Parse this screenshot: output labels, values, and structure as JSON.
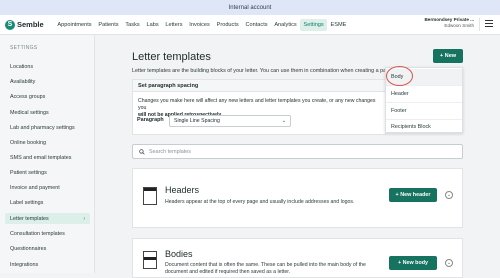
{
  "banner": {
    "text": "Internal account"
  },
  "header": {
    "logo_text": "Semble",
    "logo_glyph": "S",
    "nav": [
      "Appointments",
      "Patients",
      "Tasks",
      "Labs",
      "Letters",
      "Invoices",
      "Products",
      "Contacts",
      "Analytics",
      "Settings",
      "ESME"
    ],
    "active_nav": "Settings",
    "account_name": "Bermondsey Private ...",
    "account_user": "Edwoon Smith"
  },
  "sidebar": {
    "heading": "SETTINGS",
    "items": [
      "Locations",
      "Availability",
      "Access groups",
      "Medical settings",
      "Lab and pharmacy settings",
      "Online booking",
      "SMS and email templates",
      "Patient settings",
      "Invoice and payment",
      "Label settings",
      "Letter templates",
      "Consultation templates",
      "Questionnaires",
      "Integrations"
    ],
    "active_item": "Letter templates"
  },
  "main": {
    "title": "Letter templates",
    "intro": "Letter templates are the building blocks of your letter. You can use them in combination when creating a patien",
    "new_button": "+ New",
    "paragraph": {
      "heading": "Set paragraph spacing",
      "text_plain": "Changes you make here will affect any new letters and letter templates you create, or any new changes you",
      "text_bold": "will not be applied retrospectively.",
      "label": "Paragraph",
      "selected": "Single Line Spacing"
    },
    "dropdown": [
      "Body",
      "Header",
      "Footer",
      "Recipients Block"
    ],
    "search_placeholder": "Search templates",
    "sections": [
      {
        "title": "Headers",
        "description": "Headers appear at the top of every page and usually include addresses and logos.",
        "button": "+ New header"
      },
      {
        "title": "Bodies",
        "description": "Document content that is often the same. These can be pulled into the main body of the document and edited if required then saved as a letter.",
        "button": "+ New body"
      }
    ]
  },
  "colors": {
    "accent": "#16735f",
    "active_bg": "#dcefe9",
    "highlight_circle": "#d9534f"
  }
}
